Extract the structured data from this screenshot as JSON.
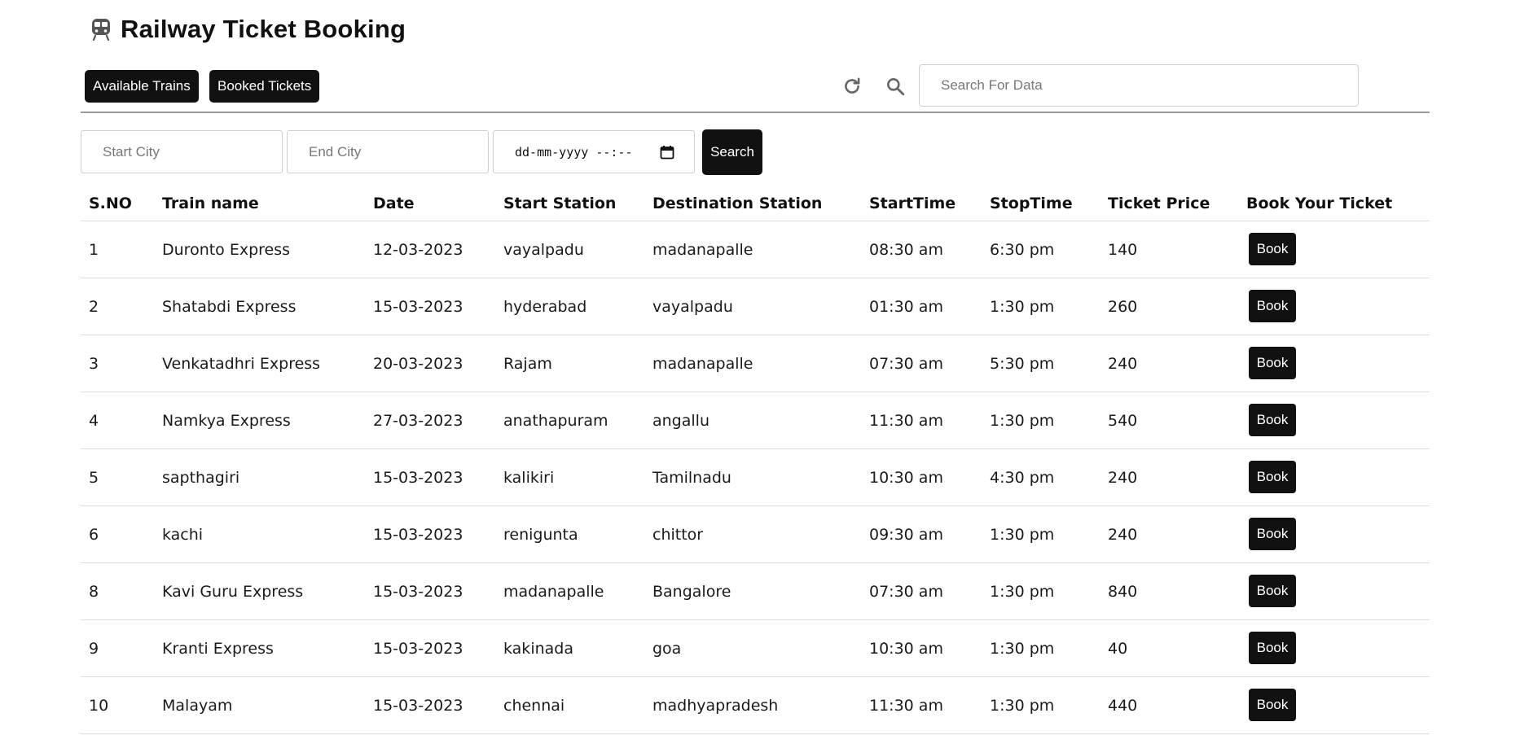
{
  "header": {
    "icon": "train-icon",
    "title": "Railway Ticket Booking"
  },
  "toolbar": {
    "available_trains_label": "Available Trains",
    "booked_tickets_label": "Booked Tickets",
    "refresh_icon": "refresh-icon",
    "search_icon": "search-icon",
    "search_placeholder": "Search For Data"
  },
  "filters": {
    "start_city_placeholder": "Start City",
    "end_city_placeholder": "End City",
    "date_value": "dd-mm-yyyy --:--",
    "calendar_icon": "calendar-icon",
    "search_label": "Search"
  },
  "table": {
    "columns": [
      "S.NO",
      "Train name",
      "Date",
      "Start Station",
      "Destination Station",
      "StartTime",
      "StopTime",
      "Ticket Price",
      "Book Your Ticket"
    ],
    "book_label": "Book",
    "rows": [
      {
        "sno": "1",
        "name": "Duronto Express",
        "date": "12-03-2023",
        "start": "vayalpadu",
        "dest": "madanapalle",
        "start_time": "08:30 am",
        "stop_time": "6:30 pm",
        "price": "140"
      },
      {
        "sno": "2",
        "name": "Shatabdi Express",
        "date": "15-03-2023",
        "start": "hyderabad",
        "dest": "vayalpadu",
        "start_time": "01:30 am",
        "stop_time": "1:30 pm",
        "price": "260"
      },
      {
        "sno": "3",
        "name": "Venkatadhri Express",
        "date": "20-03-2023",
        "start": "Rajam",
        "dest": "madanapalle",
        "start_time": "07:30 am",
        "stop_time": "5:30 pm",
        "price": "240"
      },
      {
        "sno": "4",
        "name": "Namkya Express",
        "date": "27-03-2023",
        "start": "anathapuram",
        "dest": "angallu",
        "start_time": "11:30 am",
        "stop_time": "1:30 pm",
        "price": "540"
      },
      {
        "sno": "5",
        "name": "sapthagiri",
        "date": "15-03-2023",
        "start": "kalikiri",
        "dest": "Tamilnadu",
        "start_time": "10:30 am",
        "stop_time": "4:30 pm",
        "price": "240"
      },
      {
        "sno": "6",
        "name": "kachi",
        "date": "15-03-2023",
        "start": "renigunta",
        "dest": "chittor",
        "start_time": "09:30 am",
        "stop_time": "1:30 pm",
        "price": "240"
      },
      {
        "sno": "8",
        "name": "Kavi Guru Express",
        "date": "15-03-2023",
        "start": "madanapalle",
        "dest": "Bangalore",
        "start_time": "07:30 am",
        "stop_time": "1:30 pm",
        "price": "840"
      },
      {
        "sno": "9",
        "name": "Kranti Express",
        "date": "15-03-2023",
        "start": "kakinada",
        "dest": "goa",
        "start_time": "10:30 am",
        "stop_time": "1:30 pm",
        "price": "40"
      },
      {
        "sno": "10",
        "name": "Malayam",
        "date": "15-03-2023",
        "start": "chennai",
        "dest": "madhyapradesh",
        "start_time": "11:30 am",
        "stop_time": "1:30 pm",
        "price": "440"
      }
    ]
  }
}
